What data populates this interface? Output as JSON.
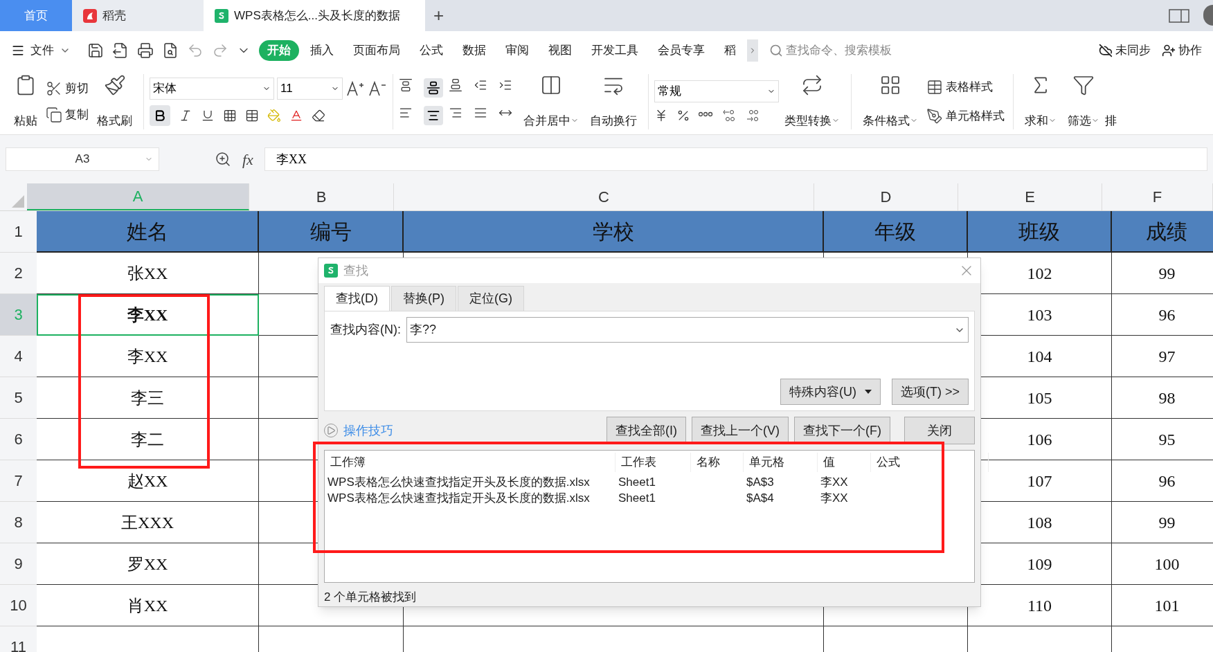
{
  "tabs": [
    {
      "label": "首页",
      "selected": false,
      "kind": "home"
    },
    {
      "label": "稻壳",
      "selected": false,
      "kind": "docer"
    },
    {
      "label": "WPS表格怎么...头及长度的数据",
      "selected": true,
      "kind": "sheet"
    }
  ],
  "tab_add": "+",
  "menu": {
    "file": "文件",
    "tabs": [
      {
        "label": "开始",
        "selected": true
      },
      {
        "label": "插入",
        "selected": false
      },
      {
        "label": "页面布局",
        "selected": false
      },
      {
        "label": "公式",
        "selected": false
      },
      {
        "label": "数据",
        "selected": false
      },
      {
        "label": "审阅",
        "selected": false
      },
      {
        "label": "视图",
        "selected": false
      },
      {
        "label": "开发工具",
        "selected": false
      },
      {
        "label": "会员专享",
        "selected": false
      },
      {
        "label": "稻",
        "selected": false
      }
    ],
    "search_placeholder": "查找命令、搜索模板",
    "sync": "未同步",
    "collab": "协作"
  },
  "ribbon": {
    "paste": "粘贴",
    "cut": "剪切",
    "copy": "复制",
    "format_painter": "格式刷",
    "font_name": "宋体",
    "font_size": "11",
    "merge": "合并居中",
    "wrap": "自动换行",
    "number_format": "常规",
    "convert": "类型转换",
    "conditional": "条件格式",
    "table_style": "表格样式",
    "cell_style": "单元格样式",
    "sum": "求和",
    "filter": "筛选",
    "sort": "排"
  },
  "formula_bar": {
    "name_box": "A3",
    "fx": "fx",
    "formula": "李XX"
  },
  "columns": [
    {
      "label": "A",
      "selected": true
    },
    {
      "label": "B",
      "selected": false
    },
    {
      "label": "C",
      "selected": false
    },
    {
      "label": "D",
      "selected": false
    },
    {
      "label": "E",
      "selected": false
    },
    {
      "label": "F",
      "selected": false
    }
  ],
  "rows": [
    {
      "label": "1",
      "kind": "header",
      "selected": false,
      "cells": [
        "姓名",
        "编号",
        "学校",
        "年级",
        "班级",
        "成绩"
      ]
    },
    {
      "label": "2",
      "kind": "data",
      "selected": false,
      "cells": [
        "张XX",
        null,
        null,
        null,
        "102",
        "99"
      ]
    },
    {
      "label": "3",
      "kind": "data",
      "selected": true,
      "cells": [
        "李XX",
        null,
        null,
        null,
        "103",
        "96"
      ]
    },
    {
      "label": "4",
      "kind": "data",
      "selected": false,
      "cells": [
        "李XX",
        null,
        null,
        null,
        "104",
        "97"
      ]
    },
    {
      "label": "5",
      "kind": "data",
      "selected": false,
      "cells": [
        "李三",
        null,
        null,
        null,
        "105",
        "98"
      ]
    },
    {
      "label": "6",
      "kind": "data",
      "selected": false,
      "cells": [
        "李二",
        null,
        null,
        null,
        "106",
        "95"
      ]
    },
    {
      "label": "7",
      "kind": "data",
      "selected": false,
      "cells": [
        "赵XX",
        null,
        null,
        null,
        "107",
        "96"
      ]
    },
    {
      "label": "8",
      "kind": "data",
      "selected": false,
      "cells": [
        "王XXX",
        null,
        null,
        null,
        "108",
        "99"
      ]
    },
    {
      "label": "9",
      "kind": "data",
      "selected": false,
      "cells": [
        "罗XX",
        null,
        null,
        null,
        "109",
        "100"
      ]
    },
    {
      "label": "10",
      "kind": "data",
      "selected": false,
      "cells": [
        "肖XX",
        null,
        null,
        null,
        "110",
        "101"
      ]
    },
    {
      "label": "11",
      "kind": "data",
      "selected": false,
      "cells": [
        null,
        null,
        null,
        null,
        null,
        null
      ]
    }
  ],
  "dialog": {
    "title": "查找",
    "tabs": [
      {
        "label": "查找(D)",
        "selected": true
      },
      {
        "label": "替换(P)",
        "selected": false
      },
      {
        "label": "定位(G)",
        "selected": false
      }
    ],
    "find_label": "查找内容(N):",
    "find_value": "李??",
    "special": "特殊内容(U)",
    "options": "选项(T) >>",
    "tips": "操作技巧",
    "actions": [
      "查找全部(I)",
      "查找上一个(V)",
      "查找下一个(F)"
    ],
    "close": "关闭",
    "result_columns": [
      "工作簿",
      "工作表",
      "名称",
      "单元格",
      "值",
      "公式"
    ],
    "results": [
      {
        "workbook": "WPS表格怎么快速查找指定开头及长度的数据.xlsx",
        "sheet": "Sheet1",
        "cell": "$A$3",
        "value": "李XX"
      },
      {
        "workbook": "WPS表格怎么快速查找指定开头及长度的数据.xlsx",
        "sheet": "Sheet1",
        "cell": "$A$4",
        "value": "李XX"
      }
    ],
    "status": "2 个单元格被找到"
  }
}
